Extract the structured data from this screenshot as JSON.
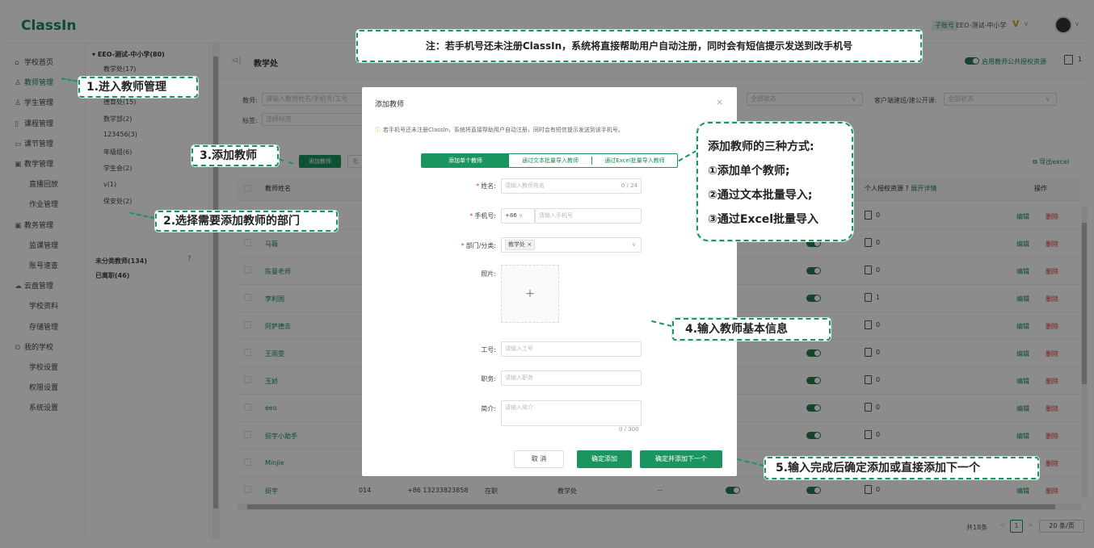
{
  "app": {
    "logo": "ClassIn"
  },
  "account": {
    "tag": "子账号",
    "name": "EEO-测试-中小学",
    "vip": "V",
    "caret": "∨"
  },
  "nav": [
    {
      "label": "学校首页",
      "icon": "home-icon",
      "glyph": "⌂"
    },
    {
      "label": "教师管理",
      "icon": "teacher-icon",
      "glyph": "♙",
      "active": true
    },
    {
      "label": "学生管理",
      "icon": "student-icon",
      "glyph": "♙"
    },
    {
      "label": "课程管理",
      "icon": "course-icon",
      "glyph": "▯"
    },
    {
      "label": "课节管理",
      "icon": "lesson-icon",
      "glyph": "▭"
    },
    {
      "label": "教学管理",
      "icon": "teaching-icon",
      "glyph": "▣"
    },
    {
      "label": "直播回放",
      "sub": true
    },
    {
      "label": "作业管理",
      "sub": true
    },
    {
      "label": "教务管理",
      "icon": "affairs-icon",
      "glyph": "▣"
    },
    {
      "label": "监课管理",
      "sub": true
    },
    {
      "label": "账号速查",
      "sub": true
    },
    {
      "label": "云盘管理",
      "icon": "cloud-icon",
      "glyph": "☁"
    },
    {
      "label": "学校资料",
      "sub": true
    },
    {
      "label": "存储管理",
      "sub": true
    },
    {
      "label": "我的学校",
      "icon": "school-icon",
      "glyph": "⊙"
    },
    {
      "label": "学校设置",
      "sub": true
    },
    {
      "label": "权限设置",
      "sub": true
    },
    {
      "label": "系统设置",
      "sub": true
    }
  ],
  "tree": {
    "root": "EEO-测试-中小学(80)",
    "items": [
      "教学处(17)",
      "教务处(11)",
      "德育处(15)",
      "数学部(2)",
      "123456(3)",
      "年级组(6)",
      "学生会(2)",
      "v(1)",
      "保安处(2)"
    ],
    "uncategorized": "未分类教师(134)",
    "resigned": "已离职(46)",
    "help": "?"
  },
  "page": {
    "title": "教学处",
    "back": "⊲|",
    "toggle_label": "启用教师公共授权资源",
    "head_count": "1"
  },
  "filters": {
    "teacher_label": "教师:",
    "teacher_placeholder": "请输入教师姓名/手机号/工号",
    "tag_label": "标签:",
    "tag_placeholder": "选择标签",
    "status_value": "全部状态",
    "class_label": "客户端建班/建公开课:",
    "class_value": "全部状态"
  },
  "toolbar": {
    "add": "添加教师",
    "more": "批",
    "export": "导出excel"
  },
  "table": {
    "headers": {
      "name": "教师姓名",
      "col2": "工",
      "resource": "个人授权资源",
      "expand": "展开详情",
      "ops": "操作"
    },
    "rows": [
      {
        "name": "",
        "res": "0"
      },
      {
        "name": "马薇",
        "res": "0"
      },
      {
        "name": "陈曼老师",
        "res": "0"
      },
      {
        "name": "李利国",
        "res": "1"
      },
      {
        "name": "阿萨德去",
        "res": "0"
      },
      {
        "name": "王雨雯",
        "res": "0"
      },
      {
        "name": "玉娇",
        "res": "0"
      },
      {
        "name": "eeo",
        "res": "0"
      },
      {
        "name": "挺宇小助手",
        "res": "0"
      },
      {
        "name": "Minjie",
        "res": "0"
      },
      {
        "name": "挺宇",
        "res": "0",
        "id": "014",
        "phone": "+86 13233823858",
        "status": "在职",
        "dept": "教学处",
        "extra": "--"
      }
    ],
    "edit": "编辑",
    "del": "删除"
  },
  "pager": {
    "total": "共18条",
    "page": "1",
    "size": "20 条/页"
  },
  "modal": {
    "title": "添加教师",
    "close": "×",
    "tip": "若手机号还未注册ClassIn，系统将直接帮助用户自动注册，同时会有短信提示发送到该手机号。",
    "tabs": [
      "添加单个教师",
      "通过文本批量导入教师",
      "通过Excel批量导入教师"
    ],
    "name_label": "姓名:",
    "name_placeholder": "请输入教师姓名",
    "name_count": "0 / 24",
    "phone_label": "手机号:",
    "phone_code": "+86",
    "phone_placeholder": "请输入手机号",
    "dept_label": "部门/分类:",
    "dept_chip": "教学处 ×",
    "photo_label": "照片:",
    "photo_plus": "+",
    "id_label": "工号:",
    "id_placeholder": "请输入工号",
    "title_label": "职务:",
    "title_placeholder": "请输入职务",
    "intro_label": "简介:",
    "intro_placeholder": "请输入简介",
    "intro_count": "0 / 300",
    "cancel": "取 消",
    "confirm": "确定添加",
    "confirm_next": "确定并添加下一个"
  },
  "annotations": {
    "note": "注：若手机号还未注册ClassIn，系统将直接帮助用户自动注册，同时会有短信提示发送到改手机号",
    "step1": "1.进入教师管理",
    "step2": "2.选择需要添加教师的部门",
    "step3": "3.添加教师",
    "step4": "4.输入教师基本信息",
    "step5": "5.输入完成后确定添加或直接添加下一个",
    "ways_title": "添加教师的三种方式:",
    "way1": "①添加单个教师;",
    "way2": "②通过文本批量导入;",
    "way3": "③通过Excel批量导入"
  },
  "colors": {
    "brand": "#1a9560",
    "danger": "#e03a3a"
  }
}
